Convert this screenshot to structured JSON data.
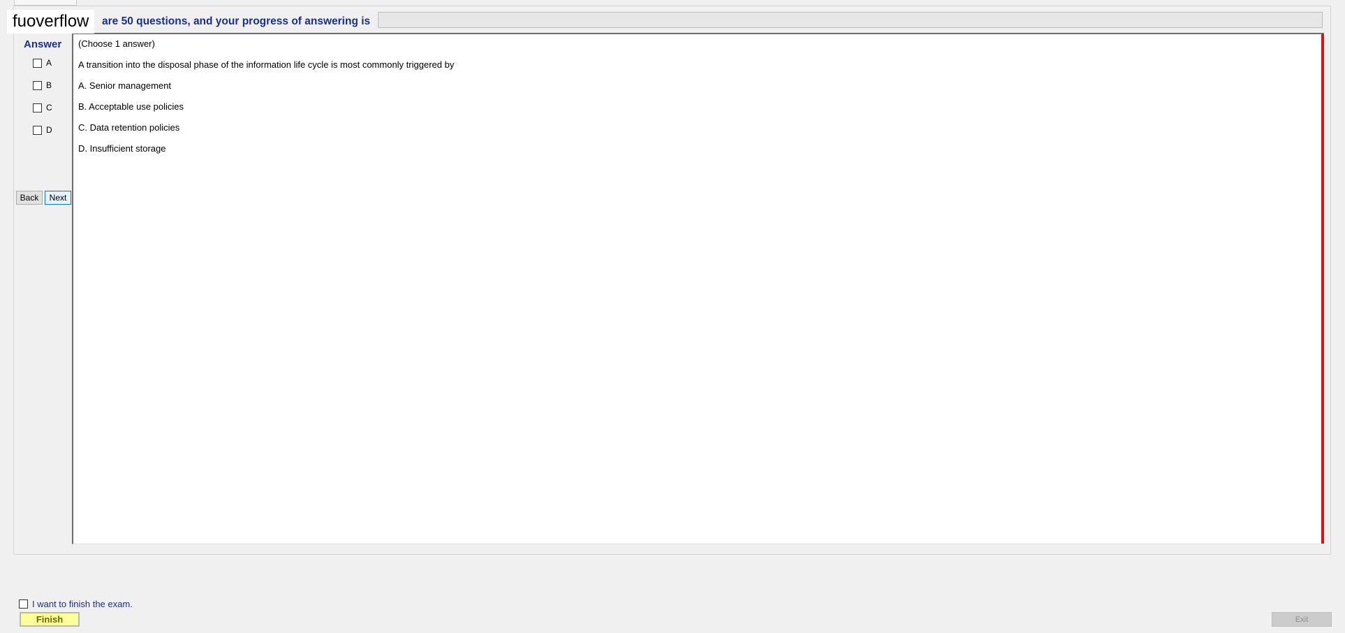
{
  "watermark": "fuoverflow",
  "header": {
    "progress_text": "are 50 questions, and your progress of answering is",
    "progress_fraction": 0
  },
  "answer_panel": {
    "title": "Answer",
    "options": [
      "A",
      "B",
      "C",
      "D"
    ],
    "back_label": "Back",
    "next_label": "Next"
  },
  "question": {
    "instruction": "(Choose 1 answer)",
    "text": "A transition into the disposal phase of the information life cycle is most commonly triggered by",
    "choices": [
      "A.  Senior management",
      "B.  Acceptable use policies",
      "C.  Data retention policies",
      "D.  Insufficient storage"
    ]
  },
  "footer": {
    "finish_check_label": "I want to finish the exam.",
    "finish_label": "Finish",
    "exit_label": "Exit"
  },
  "colors": {
    "heading_blue": "#1a2f8c",
    "rail_red": "#e01010",
    "finish_yellow": "#ffff99"
  }
}
